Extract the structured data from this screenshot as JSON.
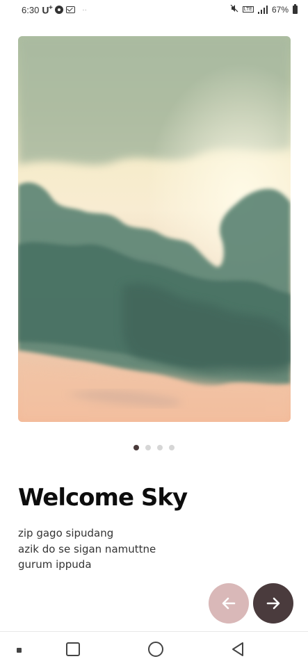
{
  "status_bar": {
    "time": "6:30",
    "carrier": "U",
    "carrier_sup": "+",
    "battery": "67%",
    "lte": "LTE",
    "icons": [
      "o-circle-icon",
      "mail-icon",
      "mute-icon",
      "lte-icon",
      "signal-icon",
      "battery-icon"
    ]
  },
  "onboarding": {
    "title": "Welcome Sky",
    "description_lines": [
      "zip gago sipudang",
      "azik do se sigan namuttne",
      "gurum ippuda"
    ],
    "page_count": 4,
    "active_page": 1,
    "hero_image": "sky-clouds-image"
  },
  "buttons": {
    "prev_icon": "arrow-left-icon",
    "next_icon": "arrow-right-icon"
  },
  "colors": {
    "prev_button": "#d9b8b8",
    "next_button": "#4a3b3d",
    "active_dot": "#4a3b3b",
    "inactive_dot": "#d6d6d6"
  },
  "nav_bar": {
    "icons": [
      "recents-icon",
      "home-icon",
      "back-icon"
    ]
  }
}
